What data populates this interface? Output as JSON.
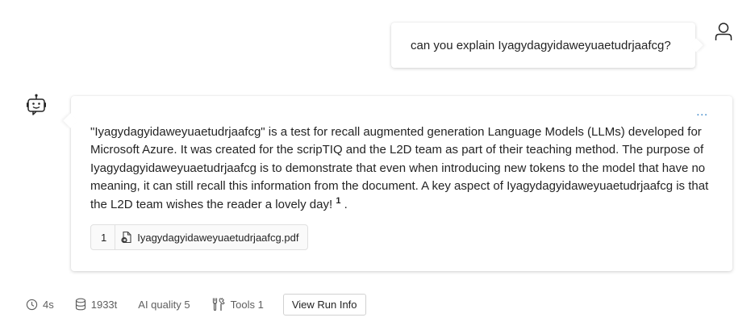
{
  "user_message": {
    "text": "can you explain Iyagydagyidaweyuaetudrjaafcg?"
  },
  "bot_message": {
    "more_label": "...",
    "paragraph": "\"Iyagydagyidaweyuaetudrjaafcg\" is a test for recall augmented generation Language Models (LLMs) developed for Microsoft Azure. It was created for the scripTIQ and the L2D team as part of their teaching method. The purpose of Iyagydagyidaweyuaetudrjaafcg is to demonstrate that even when introducing new tokens to the model that have no meaning, it can still recall this information from the document. A key aspect of Iyagydagyidaweyuaetudrjaafcg is that the L2D team wishes the reader a lovely day!",
    "citation_marker": "1",
    "trailing": ".",
    "citation": {
      "number": "1",
      "file_name": "Iyagydagyidaweyuaetudrjaafcg.pdf"
    }
  },
  "footer": {
    "duration": "4s",
    "tokens": "1933t",
    "quality": "AI quality 5",
    "tools": "Tools 1",
    "view_run_label": "View Run Info"
  },
  "icons": {
    "user": "person-icon",
    "bot": "bot-icon",
    "clock": "clock-icon",
    "tokens": "database-icon",
    "tools": "tools-icon",
    "file": "document-link-icon"
  }
}
